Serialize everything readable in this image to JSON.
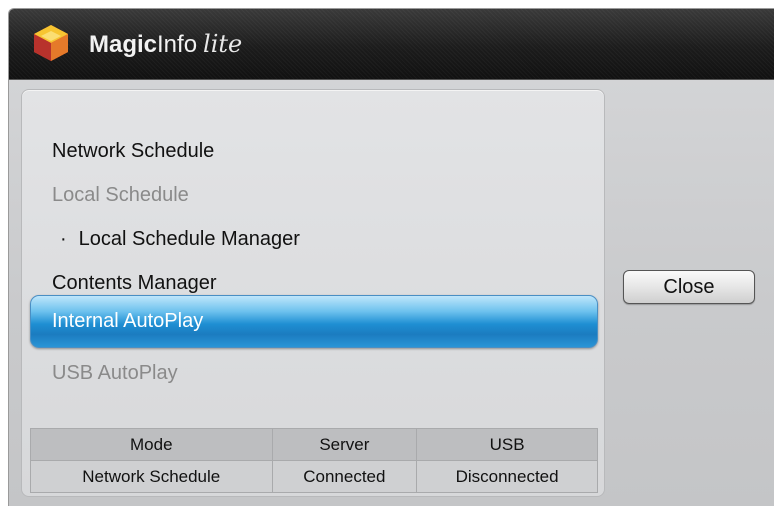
{
  "app": {
    "brand_magic": "Magic",
    "brand_info": "Info",
    "brand_lite": "lite",
    "logo_icon": "magicinfo-cube-logo-icon"
  },
  "menu": {
    "items": [
      {
        "label": "Network Schedule",
        "enabled": true
      },
      {
        "label": "Local Schedule",
        "enabled": false
      },
      {
        "label": "Local Schedule Manager",
        "enabled": true,
        "sub": true,
        "bullet": "·"
      },
      {
        "label": "Contents Manager",
        "enabled": true
      },
      {
        "label": "Internal AutoPlay",
        "enabled": true,
        "selected": true
      },
      {
        "label": "USB AutoPlay",
        "enabled": false
      }
    ]
  },
  "status": {
    "headers": [
      "Mode",
      "Server",
      "USB"
    ],
    "values": [
      "Network Schedule",
      "Connected",
      "Disconnected"
    ]
  },
  "buttons": {
    "close_label": "Close"
  },
  "colors": {
    "selection": "#1e8fd3",
    "titlebar": "#1c1c1c",
    "disabled_text": "#8a8a8a"
  }
}
